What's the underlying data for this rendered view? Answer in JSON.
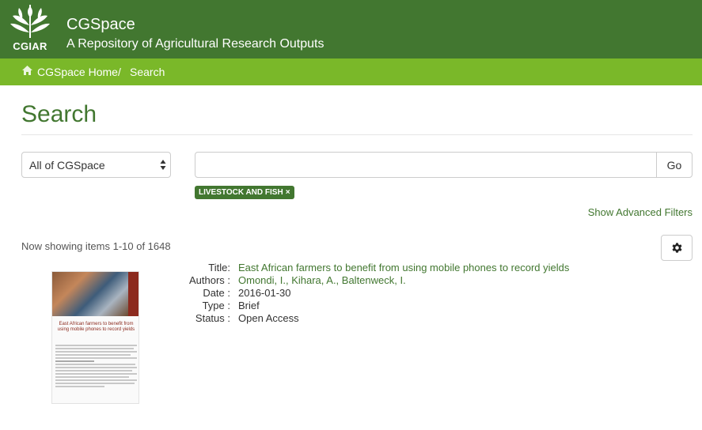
{
  "header": {
    "logo_text": "CGIAR",
    "site_name": "CGSpace",
    "site_description": "A Repository of Agricultural Research Outputs"
  },
  "breadcrumb": {
    "home": "CGSpace Home",
    "separator": "/",
    "current": "Search"
  },
  "page": {
    "title": "Search"
  },
  "search": {
    "scope": "All of CGSpace",
    "query": "",
    "go_label": "Go",
    "filter_tag": "LIVESTOCK AND FISH",
    "filter_remove": "×",
    "advanced_filters": "Show Advanced Filters"
  },
  "results": {
    "count_text": "Now showing items 1-10 of 1648",
    "items": [
      {
        "thumbnail_title": "East African farmers to benefit from using mobile phones to record yields",
        "fields": [
          {
            "label": "Title:",
            "value": "East African farmers to benefit from using mobile phones to record yields"
          },
          {
            "label": "Authors :",
            "value": "Omondi, I., Kihara, A., Baltenweck, I."
          },
          {
            "label": "Date :",
            "value": "2016-01-30"
          },
          {
            "label": "Type :",
            "value": "Brief"
          },
          {
            "label": "Status :",
            "value": "Open Access"
          }
        ]
      }
    ]
  },
  "icons": {
    "home": "home-icon",
    "gear": "gear-icon",
    "select": "select-arrows-icon",
    "logo": "cgiar-logo-icon"
  },
  "colors": {
    "header_bg": "#427730",
    "breadcrumb_bg": "#7ab829",
    "accent": "#427730"
  }
}
